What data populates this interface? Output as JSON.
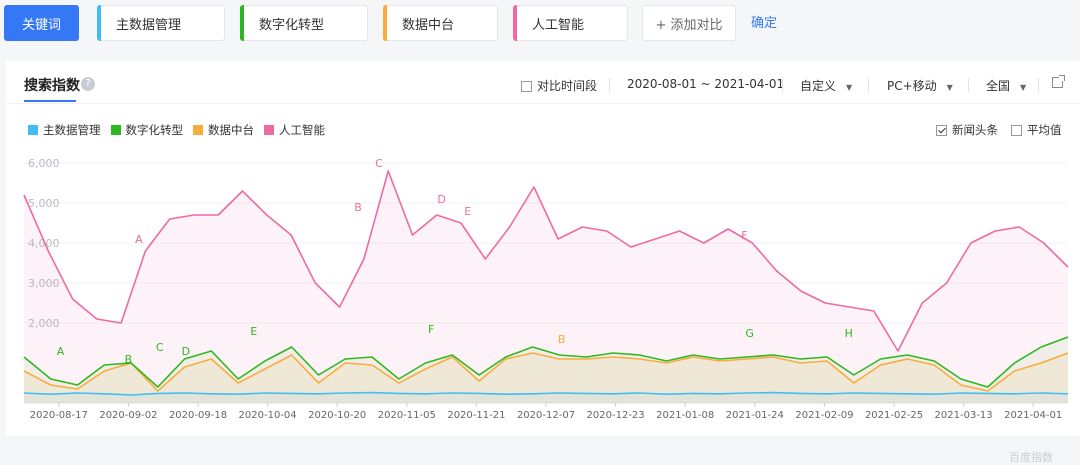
{
  "toolbar": {
    "keyword_label": "关键词",
    "terms": [
      {
        "label": "主数据管理",
        "color": "#41bdf2"
      },
      {
        "label": "数字化转型",
        "color": "#2fb81e"
      },
      {
        "label": "数据中台",
        "color": "#f9ac3d"
      },
      {
        "label": "人工智能",
        "color": "#ee6ba2"
      }
    ],
    "add_compare_label": "+ 添加对比",
    "confirm_label": "确定"
  },
  "panel": {
    "tab_title": "搜索指数",
    "help_icon": "?",
    "compare_period_label": "对比时间段",
    "date_range": "2020-08-01 ~ 2021-04-01",
    "custom_label": "自定义",
    "device_label": "PC+移动",
    "region_label": "全国",
    "news_label": "新闻头条",
    "average_label": "平均值",
    "watermark": "百度指数"
  },
  "chart_data": {
    "type": "line",
    "ylim": [
      0,
      6000
    ],
    "yticks": [
      {
        "value": 2000,
        "label": "2,000"
      },
      {
        "value": 3000,
        "label": "3,000"
      },
      {
        "value": 4000,
        "label": "4,000"
      },
      {
        "value": 5000,
        "label": "5,000"
      },
      {
        "value": 6000,
        "label": "6,000"
      }
    ],
    "x_tick_labels": [
      "2020-08-17",
      "2020-09-02",
      "2020-09-18",
      "2020-10-04",
      "2020-10-20",
      "2020-11-05",
      "2020-11-21",
      "2020-12-07",
      "2020-12-23",
      "2021-01-08",
      "2021-01-24",
      "2021-02-09",
      "2021-02-25",
      "2021-03-13",
      "2021-04-01"
    ],
    "series": [
      {
        "name": "主数据管理",
        "color": "#41bdf2",
        "values": [
          250,
          220,
          250,
          230,
          200,
          240,
          250,
          230,
          220,
          250,
          240,
          230,
          250,
          260,
          240,
          230,
          250,
          240,
          220,
          230,
          250,
          240,
          230,
          250,
          220,
          240,
          230,
          250,
          260,
          240,
          230,
          250,
          240,
          230,
          220,
          250,
          240,
          230,
          250,
          230
        ]
      },
      {
        "name": "数字化转型",
        "color": "#2fb81e",
        "values": [
          1150,
          600,
          450,
          950,
          1000,
          400,
          1100,
          1300,
          600,
          1050,
          1400,
          700,
          1100,
          1150,
          600,
          1000,
          1200,
          700,
          1150,
          1400,
          1200,
          1150,
          1250,
          1200,
          1050,
          1200,
          1100,
          1150,
          1200,
          1100,
          1150,
          700,
          1100,
          1200,
          1050,
          600,
          400,
          1000,
          1400,
          1650
        ]
      },
      {
        "name": "数据中台",
        "color": "#f9ac3d",
        "values": [
          800,
          450,
          350,
          800,
          1000,
          300,
          900,
          1100,
          500,
          850,
          1200,
          500,
          1000,
          950,
          500,
          850,
          1150,
          550,
          1100,
          1250,
          1100,
          1100,
          1150,
          1100,
          1000,
          1150,
          1050,
          1100,
          1150,
          1000,
          1050,
          500,
          950,
          1100,
          950,
          450,
          300,
          800,
          1000,
          1250
        ]
      },
      {
        "name": "人工智能",
        "color": "#ee6ba2",
        "values": [
          5200,
          3800,
          2600,
          2100,
          2000,
          3800,
          4600,
          4700,
          4700,
          5300,
          4700,
          4200,
          3000,
          2400,
          3600,
          5800,
          4200,
          4700,
          4500,
          3600,
          4400,
          5400,
          4100,
          4400,
          4300,
          3900,
          4100,
          4300,
          4000,
          4350,
          4000,
          3300,
          2800,
          2500,
          2400,
          2300,
          1300,
          2500,
          3000,
          4000,
          4300,
          4400,
          4000,
          3400
        ]
      }
    ],
    "annotations": [
      {
        "label": "A",
        "series": "人工智能",
        "value": 4000,
        "pos": 0.11
      },
      {
        "label": "B",
        "series": "人工智能",
        "value": 4800,
        "pos": 0.32
      },
      {
        "label": "C",
        "series": "人工智能",
        "value": 5900,
        "pos": 0.34
      },
      {
        "label": "D",
        "series": "人工智能",
        "value": 5000,
        "pos": 0.4
      },
      {
        "label": "E",
        "series": "人工智能",
        "value": 4700,
        "pos": 0.425
      },
      {
        "label": "F",
        "series": "人工智能",
        "value": 4100,
        "pos": 0.69
      },
      {
        "label": "E",
        "series": "数字化转型",
        "value": 1700,
        "pos": 0.22
      },
      {
        "label": "F",
        "series": "数字化转型",
        "value": 1750,
        "pos": 0.39
      },
      {
        "label": "G",
        "series": "数字化转型",
        "value": 1650,
        "pos": 0.695
      },
      {
        "label": "H",
        "series": "数字化转型",
        "value": 1650,
        "pos": 0.79
      },
      {
        "label": "B",
        "series": "数字化转型",
        "value": 1000,
        "pos": 0.1
      },
      {
        "label": "C",
        "series": "数字化转型",
        "value": 1300,
        "pos": 0.13
      },
      {
        "label": "D",
        "series": "数字化转型",
        "value": 1200,
        "pos": 0.155
      },
      {
        "label": "A",
        "series": "数字化转型",
        "value": 1200,
        "pos": 0.035
      },
      {
        "label": "B",
        "series": "数据中台",
        "value": 1500,
        "pos": 0.515
      }
    ]
  }
}
